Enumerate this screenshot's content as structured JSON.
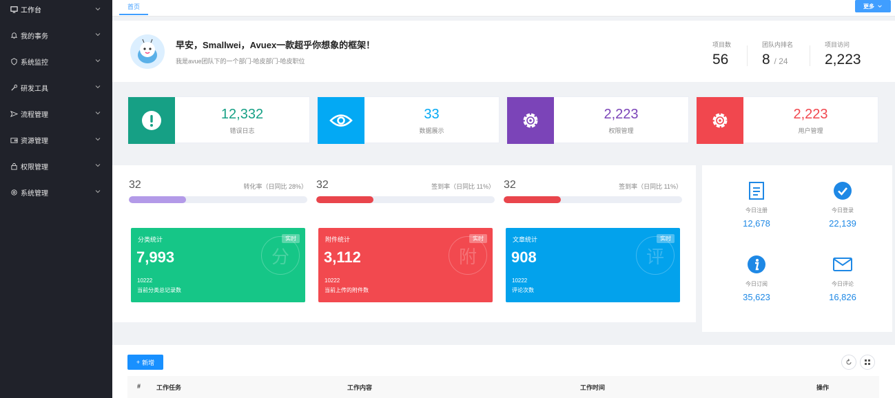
{
  "sidebar": {
    "items": [
      {
        "label": "工作台",
        "icon": "monitor-icon"
      },
      {
        "label": "我的事务",
        "icon": "bell-icon"
      },
      {
        "label": "系统监控",
        "icon": "shield-icon"
      },
      {
        "label": "研发工具",
        "icon": "tool-icon"
      },
      {
        "label": "流程管理",
        "icon": "send-icon"
      },
      {
        "label": "资源管理",
        "icon": "wallet-icon"
      },
      {
        "label": "权限管理",
        "icon": "lock-icon"
      },
      {
        "label": "系统管理",
        "icon": "settings-icon"
      }
    ]
  },
  "topbar": {
    "tab_home": "首页",
    "more_label": "更多"
  },
  "welcome": {
    "greeting": "早安，Smallwei，Avuex一款超乎你想象的框架！",
    "subtitle": "我是avue团队下的一个部门-哈皮部门-哈皮职位",
    "stats": [
      {
        "label": "项目数",
        "value": "56",
        "suffix": ""
      },
      {
        "label": "团队内排名",
        "value": "8",
        "suffix": "/ 24"
      },
      {
        "label": "项目访问",
        "value": "2,223",
        "suffix": ""
      }
    ]
  },
  "tiles": [
    {
      "value": "12,332",
      "label": "错误日志",
      "color": "#16a085",
      "icon": "exclamation-icon"
    },
    {
      "value": "33",
      "label": "数据展示",
      "color": "#03a9f4",
      "icon": "eye-icon"
    },
    {
      "value": "2,223",
      "label": "权限管理",
      "color": "#7b44b8",
      "icon": "gear-icon"
    },
    {
      "value": "2,223",
      "label": "用户管理",
      "color": "#f1474e",
      "icon": "gear-icon"
    }
  ],
  "progress": [
    {
      "value": "32",
      "label": "转化率（日同比 28%）",
      "percent": 32,
      "color": "#b39ae8"
    },
    {
      "value": "32",
      "label": "签到率（日同比 11%）",
      "percent": 32,
      "color": "#e9454c"
    },
    {
      "value": "32",
      "label": "签到率（日同比 11%）",
      "percent": 32,
      "color": "#e9454c"
    }
  ],
  "cards": [
    {
      "title": "分类统计",
      "badge": "实时",
      "value": "7,993",
      "sub": "10222",
      "desc": "当前分类总记录数",
      "color": "#16c687",
      "watermark": "分"
    },
    {
      "title": "附件统计",
      "badge": "实时",
      "value": "3,112",
      "sub": "10222",
      "desc": "当前上传的附件数",
      "color": "#f2494f",
      "watermark": "附"
    },
    {
      "title": "文章统计",
      "badge": "实时",
      "value": "908",
      "sub": "10222",
      "desc": "评论次数",
      "color": "#03a2ec",
      "watermark": "评"
    }
  ],
  "quickstats": [
    {
      "label": "今日注册",
      "value": "12,678",
      "icon": "document-icon"
    },
    {
      "label": "今日登录",
      "value": "22,139",
      "icon": "check-circle-icon"
    },
    {
      "label": "今日订阅",
      "value": "35,623",
      "icon": "info-circle-icon"
    },
    {
      "label": "今日评论",
      "value": "16,826",
      "icon": "mail-icon"
    }
  ],
  "table": {
    "add_label": "新增",
    "headers": [
      "#",
      "工作任务",
      "工作内容",
      "工作时间",
      "操作"
    ]
  },
  "colors": {
    "primary": "#409eff",
    "sidebar_bg": "#20222a"
  }
}
